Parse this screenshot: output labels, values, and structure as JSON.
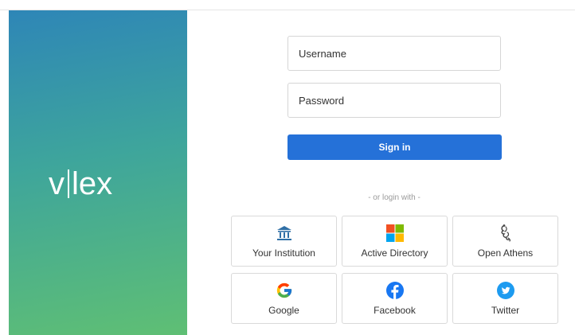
{
  "brand": {
    "logo_left": "v",
    "logo_right": "lex",
    "gradient_start": "#2e86b7",
    "gradient_end": "#5fbf74"
  },
  "form": {
    "username_placeholder": "Username",
    "password_placeholder": "Password",
    "signin_label": "Sign in",
    "signin_color": "#2571d8",
    "or_text": "- or login with -"
  },
  "providers": [
    {
      "label": "Your Institution",
      "icon": "institution-icon"
    },
    {
      "label": "Active Directory",
      "icon": "microsoft-icon"
    },
    {
      "label": "Open Athens",
      "icon": "open-athens-icon"
    },
    {
      "label": "Google",
      "icon": "google-icon"
    },
    {
      "label": "Facebook",
      "icon": "facebook-icon"
    },
    {
      "label": "Twitter",
      "icon": "twitter-icon"
    }
  ]
}
